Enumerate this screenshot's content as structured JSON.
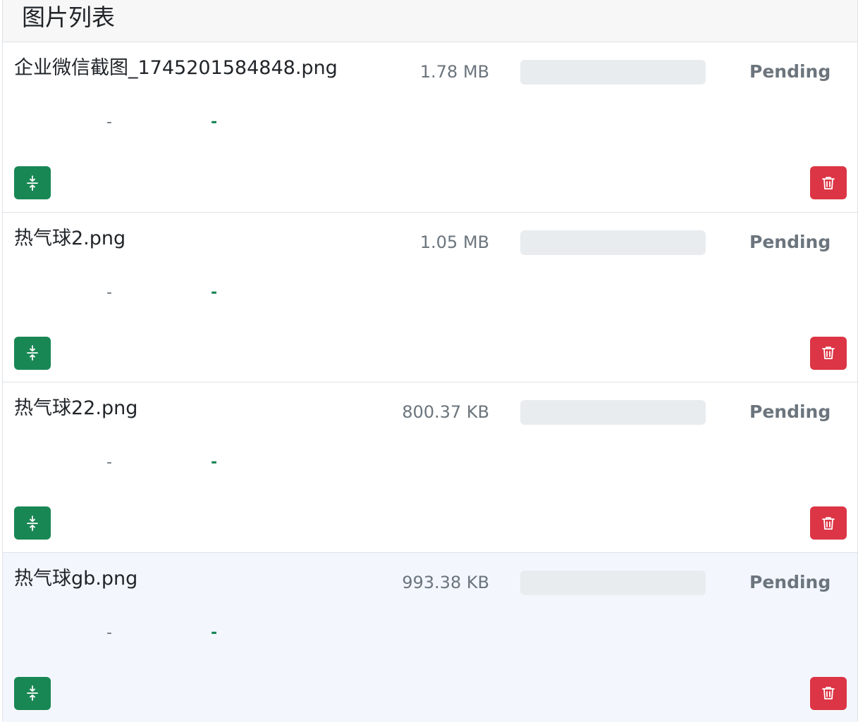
{
  "panel": {
    "title": "图片列表"
  },
  "status_colors": {
    "pending": "#6c757d",
    "compress": "#198754",
    "delete": "#dc3545"
  },
  "items": [
    {
      "name": "企业微信截图_1745201584848.png",
      "size": "1.78 MB",
      "progress": 0,
      "status": "Pending",
      "original_size": "-",
      "compressed_size": "-",
      "compress_icon": "compress-arrows-icon",
      "delete_icon": "trash-icon"
    },
    {
      "name": "热气球2.png",
      "size": "1.05 MB",
      "progress": 0,
      "status": "Pending",
      "original_size": "-",
      "compressed_size": "-",
      "compress_icon": "compress-arrows-icon",
      "delete_icon": "trash-icon"
    },
    {
      "name": "热气球22.png",
      "size": "800.37 KB",
      "progress": 0,
      "status": "Pending",
      "original_size": "-",
      "compressed_size": "-",
      "compress_icon": "compress-arrows-icon",
      "delete_icon": "trash-icon"
    },
    {
      "name": "热气球gb.png",
      "size": "993.38 KB",
      "progress": 0,
      "status": "Pending",
      "original_size": "-",
      "compressed_size": "-",
      "compress_icon": "compress-arrows-icon",
      "delete_icon": "trash-icon"
    }
  ]
}
